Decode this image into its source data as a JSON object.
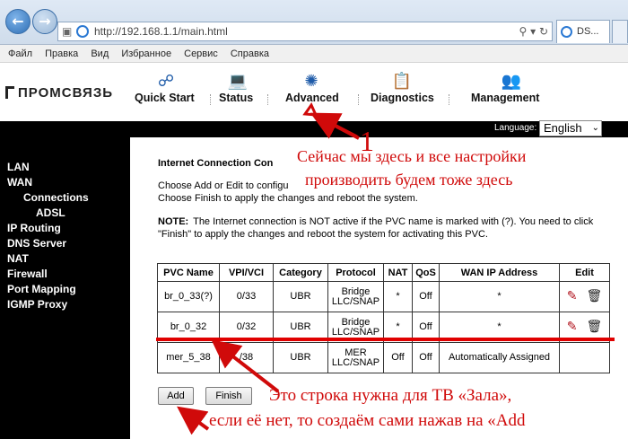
{
  "browser": {
    "url": "http://192.168.1.1/main.html",
    "tab_title": "DS...",
    "menu": [
      "Файл",
      "Правка",
      "Вид",
      "Избранное",
      "Сервис",
      "Справка"
    ]
  },
  "router": {
    "brand": "ПРОМСВЯЗЬ",
    "nav": [
      "Quick Start",
      "Status",
      "Advanced",
      "Diagnostics",
      "Management"
    ],
    "language_label": "Language:",
    "language_value": "English",
    "side_menu": [
      {
        "label": "LAN",
        "level": 0
      },
      {
        "label": "WAN",
        "level": 0
      },
      {
        "label": "Connections",
        "level": 1
      },
      {
        "label": "ADSL",
        "level": 2
      },
      {
        "label": "IP Routing",
        "level": 0
      },
      {
        "label": "DNS Server",
        "level": 0
      },
      {
        "label": "NAT",
        "level": 0
      },
      {
        "label": "Firewall",
        "level": 0
      },
      {
        "label": "Port Mapping",
        "level": 0
      },
      {
        "label": "IGMP Proxy",
        "level": 0
      }
    ]
  },
  "content": {
    "title": "Internet Connection Con",
    "line1": "Choose Add or Edit to configu",
    "line2": "Choose Finish to apply the changes and reboot the system.",
    "note_label": "NOTE:",
    "note_text": "The Internet connection is NOT active if the PVC name is marked with (?). You need to click \"Finish\" to apply the changes and reboot the system for activating this PVC.",
    "table": {
      "headers": [
        "PVC Name",
        "VPI/VCI",
        "Category",
        "Protocol",
        "NAT",
        "QoS",
        "WAN IP Address",
        "Edit"
      ],
      "rows": [
        {
          "pvc": "br_0_33(?)",
          "vpivci": "0/33",
          "category": "UBR",
          "protocol": "Bridge LLC/SNAP",
          "nat": "*",
          "qos": "Off",
          "wan_ip": "*",
          "editable": true
        },
        {
          "pvc": "br_0_32",
          "vpivci": "0/32",
          "category": "UBR",
          "protocol": "Bridge LLC/SNAP",
          "nat": "*",
          "qos": "Off",
          "wan_ip": "*",
          "editable": true
        },
        {
          "pvc": "mer_5_38",
          "vpivci": "/38",
          "category": "UBR",
          "protocol": "MER LLC/SNAP",
          "nat": "Off",
          "qos": "Off",
          "wan_ip": "Automatically Assigned",
          "editable": false
        }
      ]
    },
    "add_label": "Add",
    "finish_label": "Finish"
  },
  "annotations": {
    "number": "1",
    "top_line1": "Сейчас мы здесь и все настройки",
    "top_line2": "производить будем тоже здесь",
    "bottom_line1": "Это строка нужна для ТВ «Зала»,",
    "bottom_line2": "если её нет, то создаём сами нажав на «Add",
    "color": "#d00a0a"
  }
}
